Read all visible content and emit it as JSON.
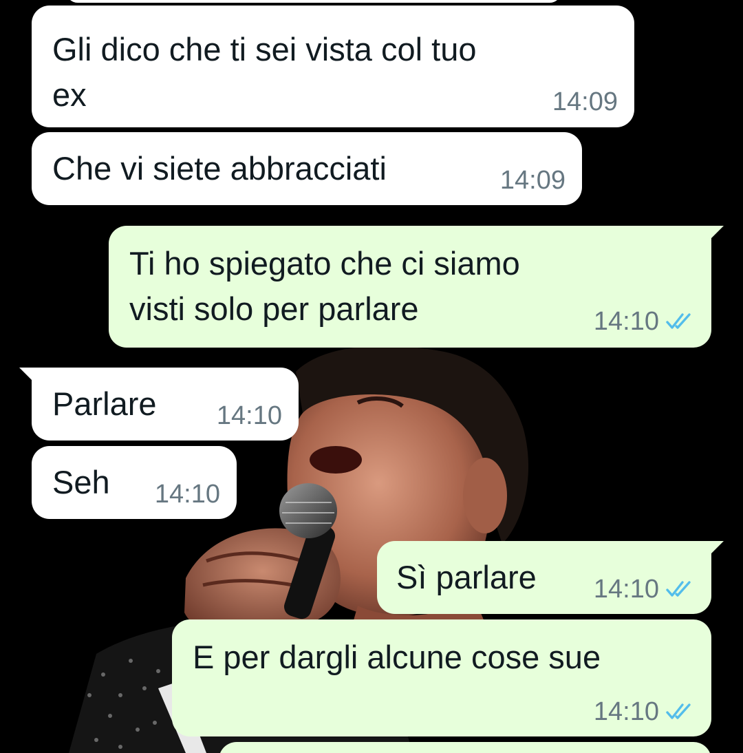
{
  "theme": {
    "incoming_bubble": "#ffffff",
    "outgoing_bubble": "#e7ffdb",
    "text_color": "#111b21",
    "meta_color": "#667781",
    "read_tick_color": "#53bdeb"
  },
  "messages": [
    {
      "direction": "incoming",
      "text": "Gli dico che ti sei vista col tuo\nex",
      "time": "14:09"
    },
    {
      "direction": "incoming",
      "text": "Che vi siete abbracciati",
      "time": "14:09"
    },
    {
      "direction": "outgoing",
      "text": "Ti ho spiegato che ci siamo\nvisti solo per parlare",
      "time": "14:10",
      "status": "read-ticks-icon"
    },
    {
      "direction": "incoming",
      "text": "Parlare",
      "time": "14:10"
    },
    {
      "direction": "incoming",
      "text": "Seh",
      "time": "14:10"
    },
    {
      "direction": "outgoing",
      "text": "Sì parlare",
      "time": "14:10",
      "status": "read-ticks-icon"
    },
    {
      "direction": "outgoing",
      "text": "E per dargli alcune cose sue",
      "time": "14:10",
      "status": "read-ticks-icon"
    }
  ]
}
